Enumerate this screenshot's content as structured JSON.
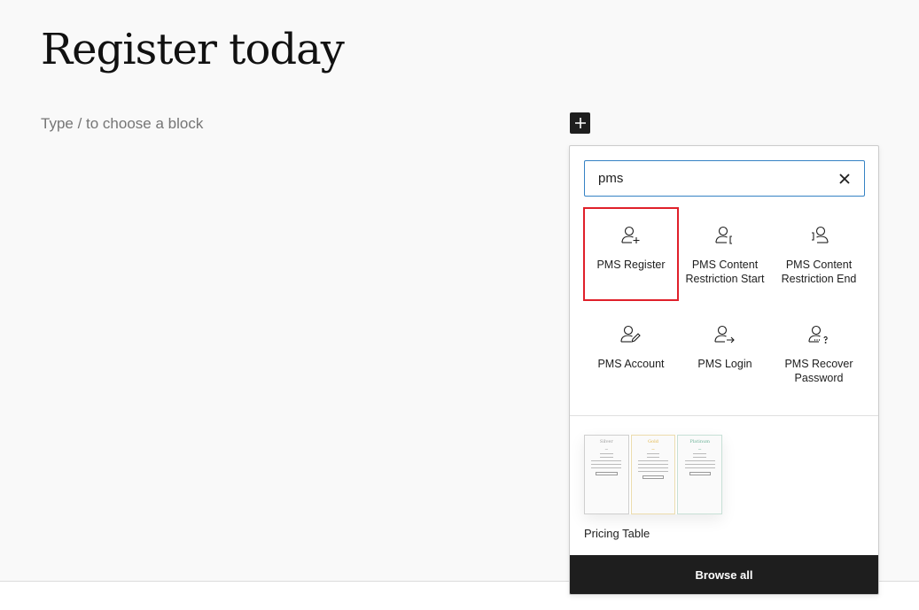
{
  "page": {
    "title": "Register today",
    "block_placeholder": "Type / to choose a block"
  },
  "inserter": {
    "toggle_icon": "plus-icon",
    "search": {
      "value": "pms",
      "placeholder": "Search",
      "clear_icon": "close-icon"
    },
    "blocks": [
      {
        "label": "PMS Register",
        "icon": "user-plus-icon",
        "highlighted": true
      },
      {
        "label": "PMS Content Restriction Start",
        "icon": "user-bracket-start-icon",
        "highlighted": false
      },
      {
        "label": "PMS Content Restriction End",
        "icon": "user-bracket-end-icon",
        "highlighted": false
      },
      {
        "label": "PMS Account",
        "icon": "user-edit-icon",
        "highlighted": false
      },
      {
        "label": "PMS Login",
        "icon": "user-arrow-icon",
        "highlighted": false
      },
      {
        "label": "PMS Recover Password",
        "icon": "user-question-icon",
        "highlighted": false
      }
    ],
    "patterns": [
      {
        "label": "Pricing Table",
        "preview_columns": [
          {
            "name": "Silver",
            "color": "#999999"
          },
          {
            "name": "Gold",
            "color": "#e2b84d"
          },
          {
            "name": "Platinum",
            "color": "#6fb59a"
          }
        ]
      }
    ],
    "browse_all_label": "Browse all"
  },
  "colors": {
    "highlight": "#e0202a",
    "focus": "#3582c4",
    "dark": "#1e1e1e"
  }
}
